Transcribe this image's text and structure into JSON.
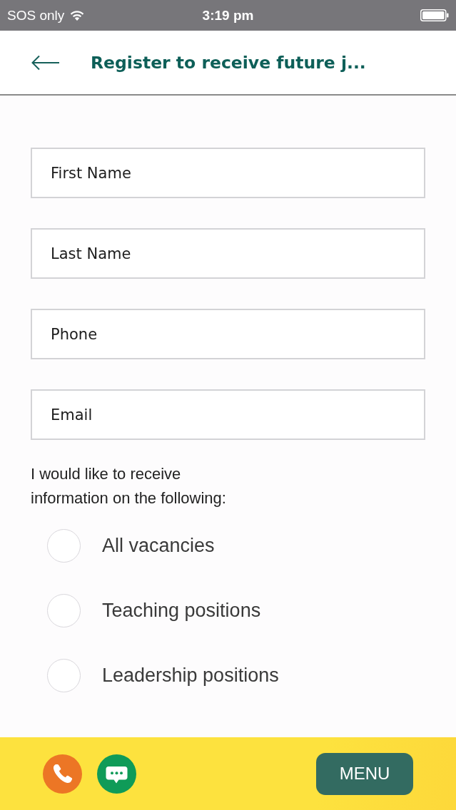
{
  "status_bar": {
    "carrier": "SOS only",
    "time": "3:19 pm"
  },
  "header": {
    "title": "Register to receive future j..."
  },
  "fields": [
    {
      "placeholder": "First Name"
    },
    {
      "placeholder": "Last Name"
    },
    {
      "placeholder": "Phone"
    },
    {
      "placeholder": "Email"
    }
  ],
  "prompt": "I would like to receive information on the following:",
  "options": [
    {
      "label": "All vacancies",
      "selected": false
    },
    {
      "label": "Teaching positions",
      "selected": false
    },
    {
      "label": "Leadership positions",
      "selected": false
    }
  ],
  "bottom_bar": {
    "menu_button": "MENU"
  }
}
